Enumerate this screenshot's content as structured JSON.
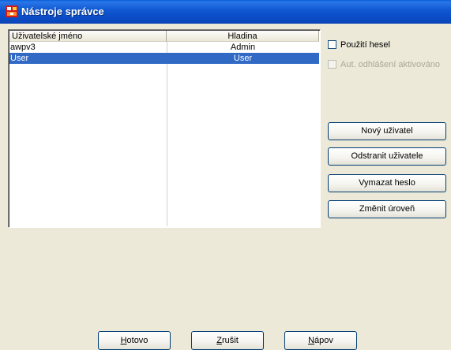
{
  "window": {
    "title": "Nástroje správce",
    "icon": "app-tools-icon"
  },
  "list": {
    "columns": [
      "Uživatelské jméno",
      "Hladina"
    ],
    "rows": [
      {
        "name": "awpv3",
        "level": "Admin",
        "selected": false
      },
      {
        "name": "User",
        "level": "User",
        "selected": true
      }
    ]
  },
  "options": {
    "use_passwords": {
      "label": "Použití hesel",
      "checked": false,
      "enabled": true
    },
    "auto_logout": {
      "label": "Aut. odhlášení aktivováno",
      "checked": false,
      "enabled": false
    }
  },
  "actions": {
    "new_user": "Nový uživatel",
    "remove_user": "Odstranit uživatele",
    "clear_password": "Vymazat heslo",
    "change_level": "Změnit úroveň"
  },
  "footer": {
    "ok": {
      "accel": "H",
      "rest": "otovo"
    },
    "cancel": {
      "accel": "Z",
      "rest": "rušit"
    },
    "help": {
      "accel": "N",
      "rest": "ápov"
    }
  },
  "colors": {
    "titlebar": "#0a49c2",
    "selection": "#316ac5",
    "window_bg": "#ece9d8"
  }
}
